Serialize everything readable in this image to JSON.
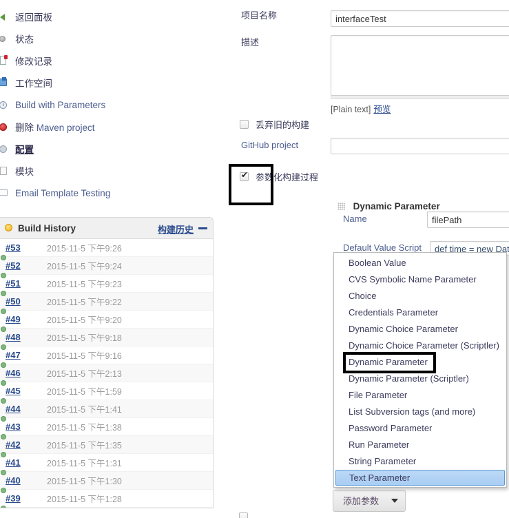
{
  "sidebar": {
    "items": [
      {
        "label": "返回面板",
        "icon": "back-arrow-icon",
        "style": "cjk"
      },
      {
        "label": "状态",
        "icon": "status-ball-icon",
        "style": "cjk"
      },
      {
        "label": "修改记录",
        "icon": "changes-doc-icon",
        "style": "cjk"
      },
      {
        "label": "工作空间",
        "icon": "workspace-folder-icon",
        "style": "cjk"
      },
      {
        "label": "Build with Parameters",
        "icon": "build-clock-icon",
        "style": "en"
      },
      {
        "label_cn": "删除",
        "label_en": " Maven project",
        "label": "删除 Maven project",
        "icon": "delete-icon",
        "style": "mixed"
      },
      {
        "label": "配置",
        "icon": "configure-gear-icon",
        "style": "active"
      },
      {
        "label": "模块",
        "icon": "modules-icon",
        "style": "cjk"
      },
      {
        "label": "Email Template Testing",
        "icon": "email-icon",
        "style": "en"
      }
    ]
  },
  "build_history": {
    "title": "Build History",
    "link_label": "构建历史",
    "collapse_icon": "minus-icon",
    "rows": [
      {
        "num": "#53",
        "date": "2015-11-5 下午9:26"
      },
      {
        "num": "#52",
        "date": "2015-11-5 下午9:24"
      },
      {
        "num": "#51",
        "date": "2015-11-5 下午9:23"
      },
      {
        "num": "#50",
        "date": "2015-11-5 下午9:22"
      },
      {
        "num": "#49",
        "date": "2015-11-5 下午9:20"
      },
      {
        "num": "#48",
        "date": "2015-11-5 下午9:18"
      },
      {
        "num": "#47",
        "date": "2015-11-5 下午9:16"
      },
      {
        "num": "#46",
        "date": "2015-11-5 下午2:13"
      },
      {
        "num": "#45",
        "date": "2015-11-5 下午1:59"
      },
      {
        "num": "#44",
        "date": "2015-11-5 下午1:41"
      },
      {
        "num": "#43",
        "date": "2015-11-5 下午1:38"
      },
      {
        "num": "#42",
        "date": "2015-11-5 下午1:35"
      },
      {
        "num": "#41",
        "date": "2015-11-5 下午1:31"
      },
      {
        "num": "#40",
        "date": "2015-11-5 下午1:30"
      },
      {
        "num": "#39",
        "date": "2015-11-5 下午1:28"
      }
    ]
  },
  "form": {
    "project_name_label": "项目名称",
    "project_name_value": "interfaceTest",
    "description_label": "描述",
    "description_value": "",
    "plain_text_label": "[Plain text]",
    "preview_link": "预览",
    "discard_old_builds_label": "丢弃旧的构建",
    "discard_old_builds_checked": false,
    "github_project_label": "GitHub project",
    "github_project_value": "",
    "parameterized_build_label": "参数化构建过程",
    "parameterized_build_checked": true
  },
  "dynamic_parameter": {
    "title": "Dynamic Parameter",
    "grip_icon": "drag-grip-icon",
    "name_label": "Name",
    "name_value": "filePath",
    "default_value_script_label": "Default Value Script",
    "default_value_script_value": "def time = new Dat"
  },
  "dropdown": {
    "items": [
      "Boolean Value",
      "CVS Symbolic Name Parameter",
      "Choice",
      "Credentials Parameter",
      "Dynamic Choice Parameter",
      "Dynamic Choice Parameter (Scriptler)",
      "Dynamic Parameter",
      "Dynamic Parameter (Scriptler)",
      "File Parameter",
      "List Subversion tags (and more)",
      "Password Parameter",
      "Run Parameter",
      "String Parameter",
      "Text Parameter"
    ],
    "selected": "Text Parameter",
    "highlighted": "Dynamic Parameter"
  },
  "add_parameter_button": {
    "label": "添加参数",
    "caret_icon": "chevron-down-icon"
  },
  "colors": {
    "link": "#2a4b8d",
    "label": "#3b3b5c",
    "selected_bg": "#a9cdf3",
    "selected_border": "#5b9bd5",
    "highlight_rect": "#000000",
    "panel_head_bg": "#f0f0f0"
  }
}
